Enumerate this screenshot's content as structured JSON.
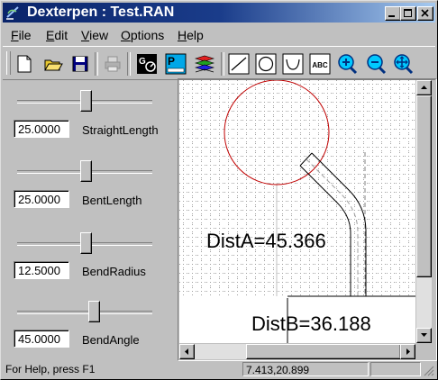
{
  "window": {
    "title": "Dexterpen : Test.RAN"
  },
  "menu": [
    {
      "label": "File",
      "key": "F",
      "rest": "ile"
    },
    {
      "label": "Edit",
      "key": "E",
      "rest": "dit"
    },
    {
      "label": "View",
      "key": "V",
      "rest": "iew"
    },
    {
      "label": "Options",
      "key": "O",
      "rest": "ptions"
    },
    {
      "label": "Help",
      "key": "H",
      "rest": "elp"
    }
  ],
  "toolbar": {
    "tools": [
      "new-icon",
      "open-icon",
      "save-icon",
      "print-icon",
      "gauge-icon",
      "panel-icon",
      "layers-icon",
      "line-icon",
      "circle-icon",
      "arc-icon",
      "text-icon",
      "zoom-in-icon",
      "zoom-out-icon",
      "zoom-fit-icon"
    ],
    "text_tool_label": "ABC"
  },
  "params": [
    {
      "value": "25.0000",
      "label": "StraightLength",
      "slider_pos": 0.5
    },
    {
      "value": "25.0000",
      "label": "BentLength",
      "slider_pos": 0.5
    },
    {
      "value": "12.5000",
      "label": "BendRadius",
      "slider_pos": 0.5
    },
    {
      "value": "45.0000",
      "label": "BendAngle",
      "slider_pos": 0.56
    }
  ],
  "canvas": {
    "dist_a": "DistA=45.366",
    "dist_b": "DistB=36.188",
    "circle_color": "#c00000"
  },
  "status": {
    "help": "For Help, press F1",
    "coords": "7.413,20.899"
  }
}
